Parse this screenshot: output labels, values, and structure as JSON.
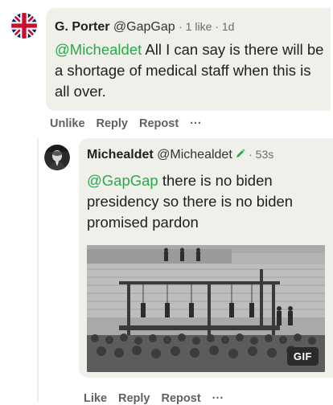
{
  "comment": {
    "author": "G. Porter",
    "handle": "@GapGap",
    "likes": "1 like",
    "time": "1d",
    "mention": "@Michealdet",
    "text": " All I can say is there will be a shortage of medical staff when this is all over.",
    "actions": {
      "unlike": "Unlike",
      "reply": "Reply",
      "repost": "Repost",
      "more": "···"
    }
  },
  "reply": {
    "author": "Michealdet",
    "handle": "@Michealdet",
    "time": "53s",
    "mention": "@GapGap",
    "text": " there is no biden presidency so there is no biden promised pardon",
    "gif_label": "GIF",
    "actions": {
      "like": "Like",
      "reply": "Reply",
      "repost": "Repost",
      "more": "···"
    }
  },
  "icons": {
    "flag": "uk-flag-icon",
    "pen": "pen-icon",
    "more": "more-icon"
  },
  "colors": {
    "accent": "#2ba94a",
    "bubble": "#eef0e9",
    "action_text": "#616161"
  }
}
